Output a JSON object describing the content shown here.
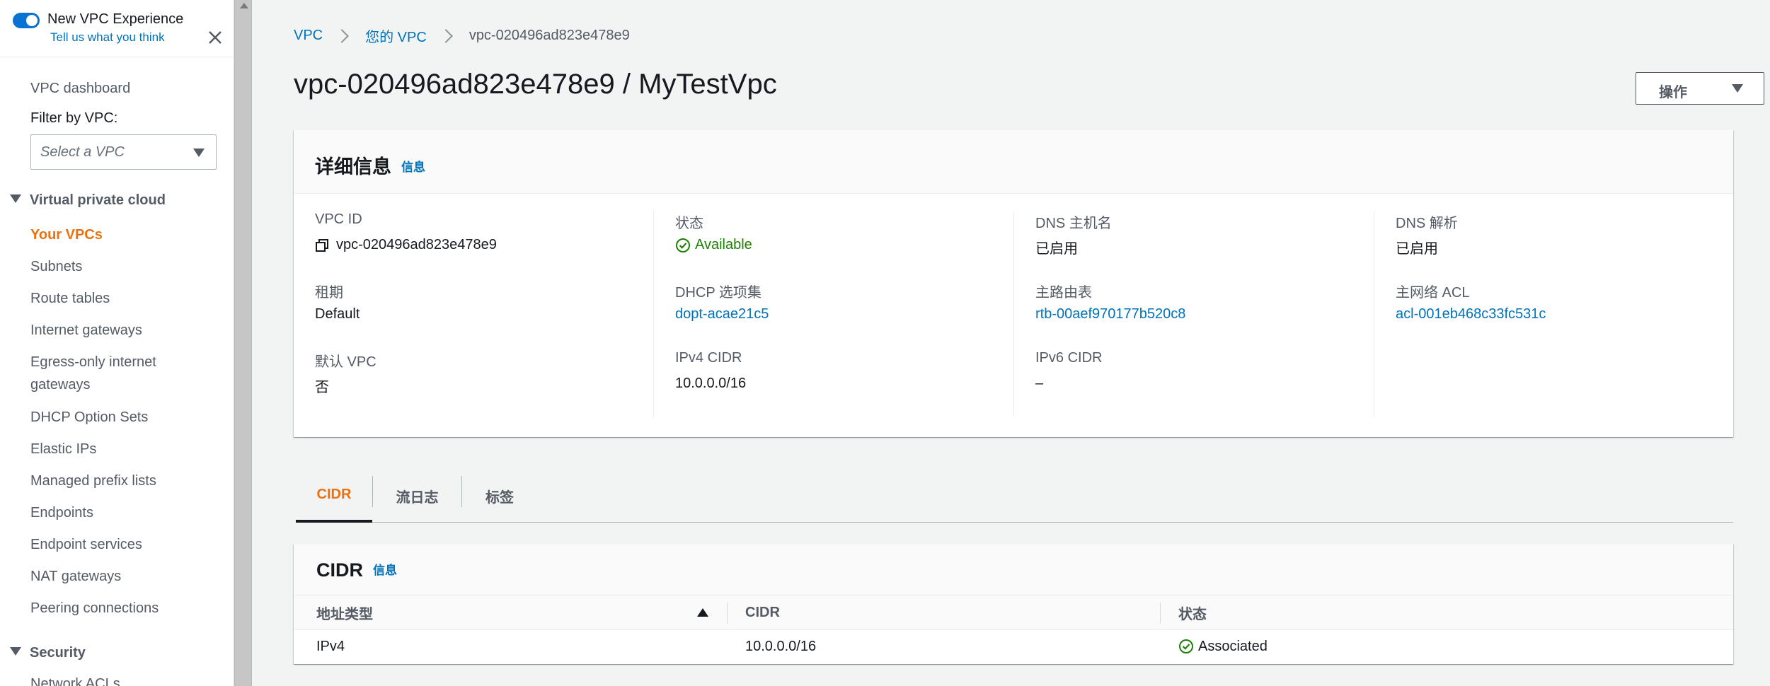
{
  "sidebar": {
    "experience_title": "New VPC Experience",
    "experience_link": "Tell us what you think",
    "dashboard": "VPC dashboard",
    "filter_label": "Filter by VPC:",
    "filter_placeholder": "Select a VPC",
    "section_vpc": "Virtual private cloud",
    "items": [
      "Your VPCs",
      "Subnets",
      "Route tables",
      "Internet gateways",
      "Egress-only internet",
      "gateways",
      "DHCP Option Sets",
      "Elastic IPs",
      "Managed prefix lists",
      "Endpoints",
      "Endpoint services",
      "NAT gateways",
      "Peering connections"
    ],
    "section_security": "Security",
    "partial_item": "Network ACLs"
  },
  "breadcrumb": {
    "root": "VPC",
    "parent": "您的 VPC",
    "current": "vpc-020496ad823e478e9"
  },
  "page": {
    "title": "vpc-020496ad823e478e9 / MyTestVpc",
    "actions_label": "操作"
  },
  "details": {
    "title": "详细信息",
    "info": "信息",
    "columns": [
      [
        {
          "label": "VPC ID",
          "value": "vpc-020496ad823e478e9"
        },
        {
          "label": "租期",
          "value": "Default"
        },
        {
          "label": "默认 VPC",
          "value": "否"
        }
      ],
      [
        {
          "label": "状态",
          "value": "Available"
        },
        {
          "label": "DHCP 选项集",
          "value": "dopt-acae21c5"
        },
        {
          "label": "IPv4 CIDR",
          "value": "10.0.0.0/16"
        }
      ],
      [
        {
          "label": "DNS 主机名",
          "value": "已启用"
        },
        {
          "label": "主路由表",
          "value": "rtb-00aef970177b520c8"
        },
        {
          "label": "IPv6 CIDR",
          "value": "–"
        }
      ],
      [
        {
          "label": "DNS 解析",
          "value": "已启用"
        },
        {
          "label": "主网络 ACL",
          "value": "acl-001eb468c33fc531c"
        }
      ]
    ]
  },
  "tabs": [
    "CIDR",
    "流日志",
    "标签"
  ],
  "cidr_table": {
    "title": "CIDR",
    "info": "信息",
    "headers": [
      "地址类型",
      "CIDR",
      "状态"
    ],
    "rows": [
      [
        "IPv4",
        "10.0.0.0/16",
        "Associated"
      ]
    ]
  },
  "colors": {
    "accent_orange": "#ec7211",
    "link_blue": "#0073bb",
    "success_green": "#1d8102",
    "toggle_blue": "#0972d3"
  },
  "icons": {
    "close": "close-icon",
    "copy": "copy-icon",
    "status_ok": "check-circle-icon",
    "dropdown": "caret-down-icon",
    "sort": "sort-ascending-icon"
  }
}
